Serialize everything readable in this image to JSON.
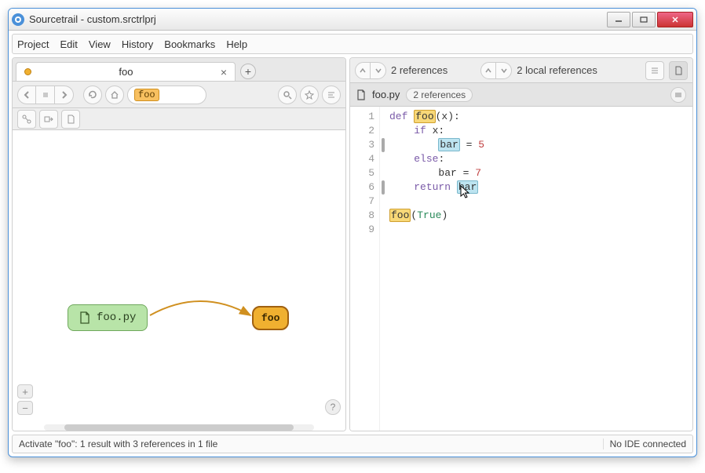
{
  "window": {
    "title": "Sourcetrail - custom.srctrlprj"
  },
  "menubar": [
    "Project",
    "Edit",
    "View",
    "History",
    "Bookmarks",
    "Help"
  ],
  "tab": {
    "label": "foo"
  },
  "search": {
    "chip": "foo"
  },
  "refs": {
    "left": "2 references",
    "right": "2 local references"
  },
  "file": {
    "name": "foo.py",
    "ref_pill": "2 references"
  },
  "graph": {
    "file_node": "foo.py",
    "func_node": "foo"
  },
  "code": {
    "lines": [
      {
        "n": 1,
        "marker": false
      },
      {
        "n": 2,
        "marker": false
      },
      {
        "n": 3,
        "marker": true
      },
      {
        "n": 4,
        "marker": false
      },
      {
        "n": 5,
        "marker": false
      },
      {
        "n": 6,
        "marker": true
      },
      {
        "n": 7,
        "marker": false
      },
      {
        "n": 8,
        "marker": false
      },
      {
        "n": 9,
        "marker": false
      }
    ],
    "tokens": {
      "def": "def",
      "foo": "foo",
      "params": "(x):",
      "if": "if",
      "ifcond": " x:",
      "bar": "bar",
      "eq5": " = ",
      "five": "5",
      "else": "else",
      "elsec": ":",
      "eq7": "bar = ",
      "seven": "7",
      "return": "return",
      "sp": " ",
      "call_open": "(",
      "true": "True",
      "call_close": ")"
    }
  },
  "status": {
    "left": "Activate \"foo\": 1 result with 3 references in 1 file",
    "right": "No IDE connected"
  }
}
